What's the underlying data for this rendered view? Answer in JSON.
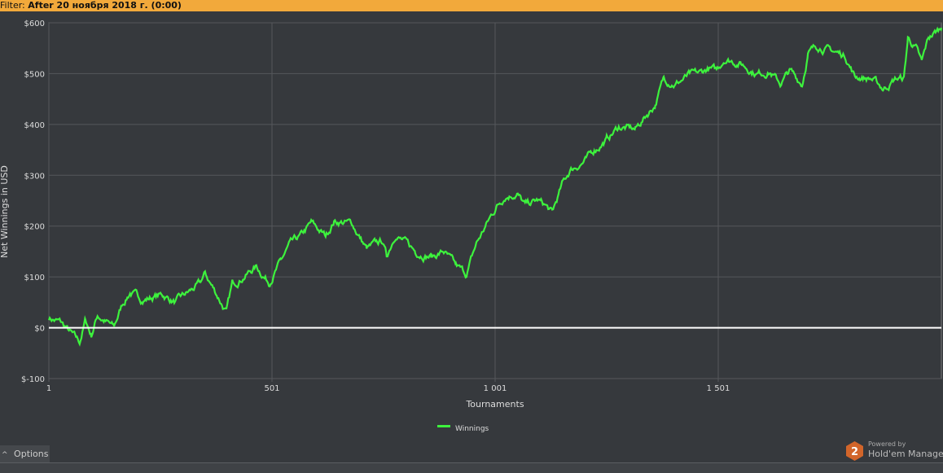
{
  "filter": {
    "label": "Filter:",
    "value": "After 20 ноября 2018 г. (0:00)"
  },
  "options_label": "Options",
  "powered": {
    "small": "Powered by",
    "brand": "Hold'em Manager",
    "logo_digit": "2"
  },
  "colors": {
    "line": "#3df23d",
    "zero_line": "#ffffff",
    "grid": "#55585c",
    "background": "#36393d",
    "filter_bar": "#f2a93b"
  },
  "chart_data": {
    "type": "line",
    "xlabel": "Tournaments",
    "ylabel": "Net Winnings in USD",
    "xlim": [
      1,
      2001
    ],
    "ylim": [
      -100,
      600
    ],
    "yticks": [
      -100,
      0,
      100,
      200,
      300,
      400,
      500,
      600
    ],
    "ytick_labels": [
      "$-100",
      "$0",
      "$100",
      "$200",
      "$300",
      "$400",
      "$500",
      "$600"
    ],
    "xticks": [
      1,
      501,
      1001,
      1501
    ],
    "xtick_labels": [
      "1",
      "501",
      "1 001",
      "1 501"
    ],
    "grid": true,
    "legend": {
      "position": "bottom-center",
      "entries": [
        "Winnings"
      ]
    },
    "series": [
      {
        "name": "Winnings",
        "points": [
          [
            1,
            20
          ],
          [
            28,
            10
          ],
          [
            70,
            -30
          ],
          [
            83,
            15
          ],
          [
            96,
            -15
          ],
          [
            110,
            25
          ],
          [
            147,
            0
          ],
          [
            165,
            45
          ],
          [
            183,
            70
          ],
          [
            211,
            55
          ],
          [
            256,
            65
          ],
          [
            284,
            50
          ],
          [
            339,
            85
          ],
          [
            351,
            105
          ],
          [
            381,
            60
          ],
          [
            399,
            30
          ],
          [
            412,
            85
          ],
          [
            466,
            120
          ],
          [
            494,
            90
          ],
          [
            521,
            130
          ],
          [
            539,
            160
          ],
          [
            567,
            180
          ],
          [
            589,
            205
          ],
          [
            621,
            180
          ],
          [
            640,
            210
          ],
          [
            680,
            205
          ],
          [
            713,
            155
          ],
          [
            749,
            170
          ],
          [
            758,
            140
          ],
          [
            777,
            185
          ],
          [
            822,
            150
          ],
          [
            859,
            140
          ],
          [
            886,
            150
          ],
          [
            913,
            120
          ],
          [
            937,
            105
          ],
          [
            959,
            165
          ],
          [
            986,
            210
          ],
          [
            1005,
            240
          ],
          [
            1023,
            260
          ],
          [
            1050,
            265
          ],
          [
            1068,
            240
          ],
          [
            1096,
            250
          ],
          [
            1114,
            240
          ],
          [
            1129,
            225
          ],
          [
            1151,
            280
          ],
          [
            1169,
            310
          ],
          [
            1205,
            330
          ],
          [
            1224,
            350
          ],
          [
            1251,
            370
          ],
          [
            1278,
            395
          ],
          [
            1315,
            390
          ],
          [
            1333,
            410
          ],
          [
            1360,
            440
          ],
          [
            1379,
            490
          ],
          [
            1406,
            480
          ],
          [
            1433,
            495
          ],
          [
            1461,
            500
          ],
          [
            1479,
            510
          ],
          [
            1497,
            505
          ],
          [
            1515,
            530
          ],
          [
            1552,
            520
          ],
          [
            1588,
            500
          ],
          [
            1616,
            505
          ],
          [
            1640,
            480
          ],
          [
            1661,
            505
          ],
          [
            1689,
            480
          ],
          [
            1702,
            540
          ],
          [
            1725,
            555
          ],
          [
            1753,
            545
          ],
          [
            1786,
            535
          ],
          [
            1807,
            495
          ],
          [
            1844,
            490
          ],
          [
            1871,
            470
          ],
          [
            1899,
            490
          ],
          [
            1917,
            490
          ],
          [
            1926,
            570
          ],
          [
            1944,
            550
          ],
          [
            1957,
            520
          ],
          [
            1972,
            570
          ],
          [
            2001,
            590
          ]
        ]
      }
    ]
  }
}
